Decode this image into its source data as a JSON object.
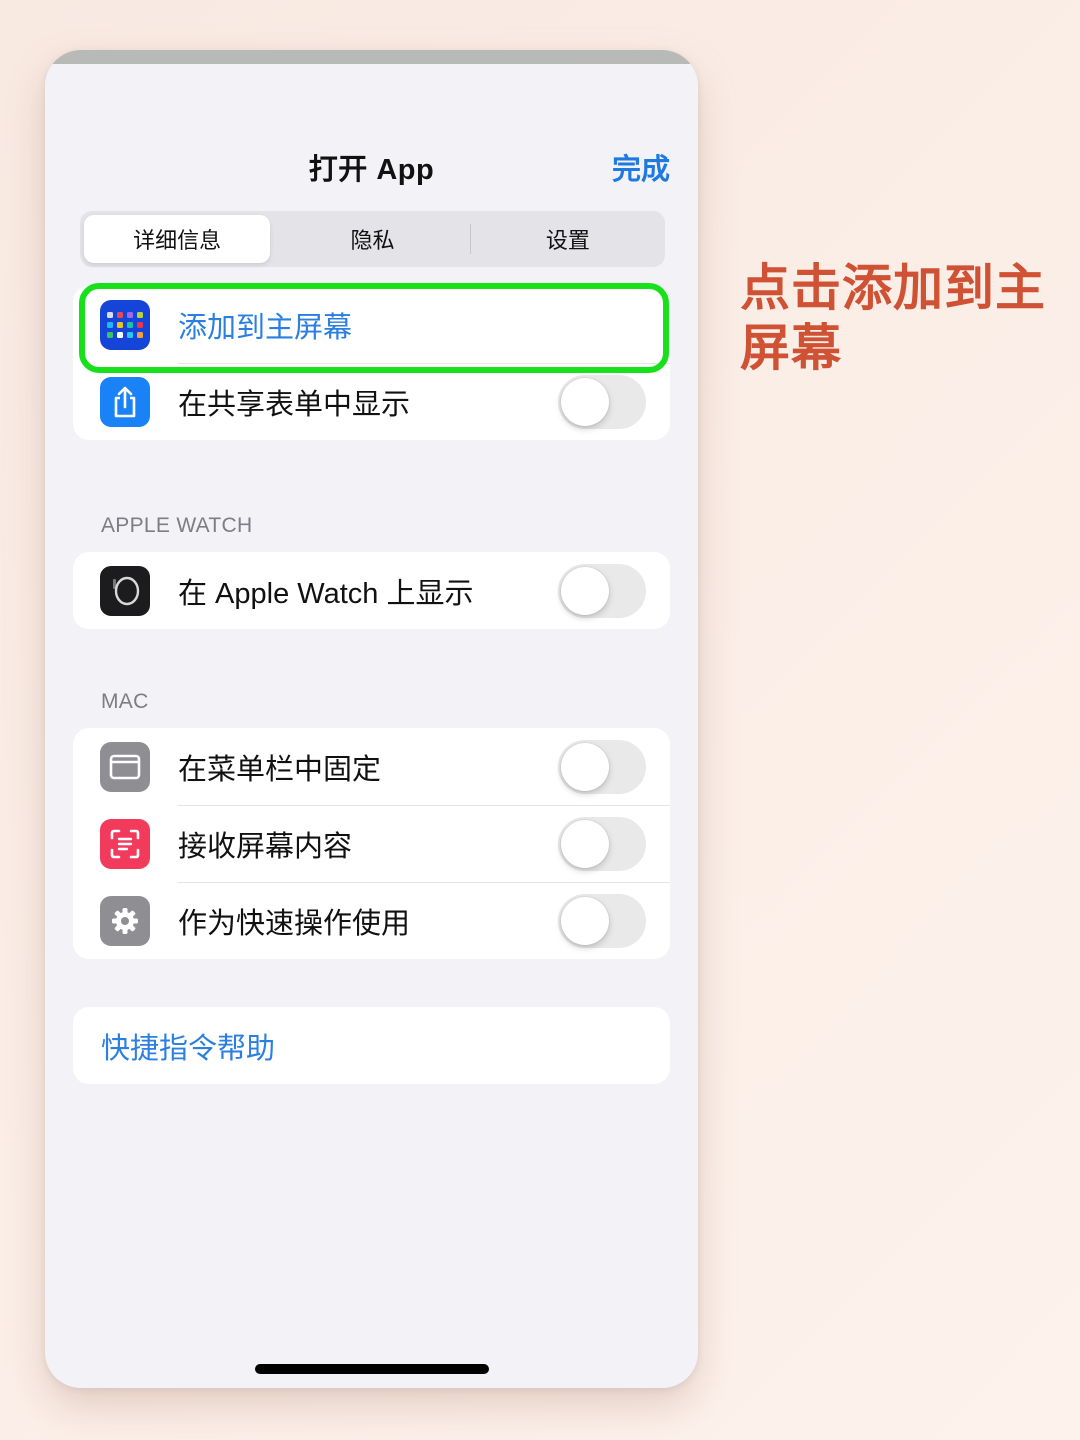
{
  "sheet": {
    "title": "打开 App",
    "done_label": "完成"
  },
  "segmented_control": {
    "tabs": [
      {
        "label": "详细信息",
        "selected": true
      },
      {
        "label": "隐私",
        "selected": false
      },
      {
        "label": "设置",
        "selected": false
      }
    ]
  },
  "groups": {
    "general": {
      "rows": [
        {
          "label": "添加到主屏幕",
          "icon": "home-screen-apps-icon",
          "icon_bg": "#1545d8",
          "style": "link",
          "highlighted": true
        },
        {
          "label": "在共享表单中显示",
          "icon": "share-icon",
          "icon_bg": "#1a82f7",
          "toggle_on": false
        }
      ]
    },
    "apple_watch": {
      "header": "APPLE WATCH",
      "rows": [
        {
          "label": "在 Apple Watch 上显示",
          "icon": "apple-watch-icon",
          "icon_bg": "#1c1c1e",
          "toggle_on": false
        }
      ]
    },
    "mac": {
      "header": "MAC",
      "rows": [
        {
          "label": "在菜单栏中固定",
          "icon": "menu-bar-icon",
          "icon_bg": "#8e8e93",
          "toggle_on": false
        },
        {
          "label": "接收屏幕内容",
          "icon": "screen-scan-icon",
          "icon_bg": "#f23a5c",
          "toggle_on": false
        },
        {
          "label": "作为快速操作使用",
          "icon": "gear-icon",
          "icon_bg": "#8e8e93",
          "toggle_on": false
        }
      ]
    },
    "help": {
      "link_label": "快捷指令帮助"
    }
  },
  "annotation": {
    "text": "点击添加到主屏幕",
    "color": "#cf5234",
    "highlight_color": "#18e01a"
  },
  "colors": {
    "accent": "#1f7ae0",
    "background": "#f2f2f7"
  }
}
